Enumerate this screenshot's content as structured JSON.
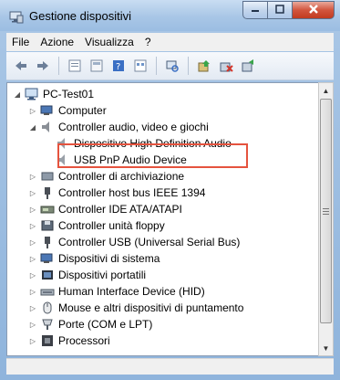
{
  "window": {
    "title": "Gestione dispositivi"
  },
  "menu": [
    "File",
    "Azione",
    "Visualizza",
    "?"
  ],
  "toolbar": [
    "back-icon",
    "forward-icon",
    "properties-icon",
    "list-view-icon",
    "help-icon",
    "details-icon",
    "scan-hardware-icon",
    "update-driver-icon",
    "uninstall-icon",
    "disable-icon"
  ],
  "tree": {
    "root": "PC-Test01",
    "items": [
      {
        "label": "Computer"
      },
      {
        "label": "Controller audio, video e giochi"
      },
      {
        "label": "Dispositivo High Definition Audio"
      },
      {
        "label": "USB PnP Audio Device"
      },
      {
        "label": "Controller di archiviazione"
      },
      {
        "label": "Controller host bus IEEE 1394"
      },
      {
        "label": "Controller IDE ATA/ATAPI"
      },
      {
        "label": "Controller unità floppy"
      },
      {
        "label": "Controller USB (Universal Serial Bus)"
      },
      {
        "label": "Dispositivi di sistema"
      },
      {
        "label": "Dispositivi portatili"
      },
      {
        "label": "Human Interface Device (HID)"
      },
      {
        "label": "Mouse e altri dispositivi di puntamento"
      },
      {
        "label": "Porte (COM e LPT)"
      },
      {
        "label": "Processori"
      }
    ]
  },
  "colors": {
    "highlight": "#e5533e"
  }
}
